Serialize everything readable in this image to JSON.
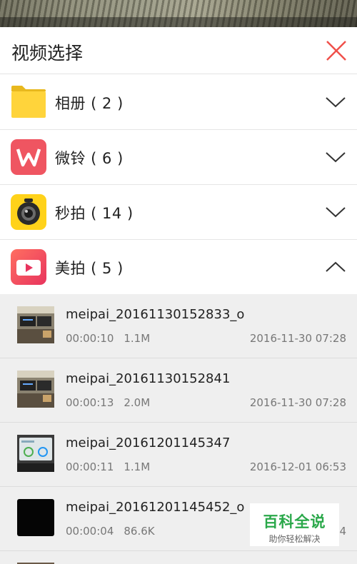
{
  "dialog": {
    "title": "视频选择"
  },
  "categories": [
    {
      "label": "相册 ( 2 )",
      "expanded": false,
      "icon": "folder-icon"
    },
    {
      "label": "微铃 ( 6 )",
      "expanded": false,
      "icon": "weiling-app-icon"
    },
    {
      "label": "秒拍 ( 14 )",
      "expanded": false,
      "icon": "miaopai-app-icon"
    },
    {
      "label": "美拍 ( 5 )",
      "expanded": true,
      "icon": "meipai-app-icon"
    }
  ],
  "videos": [
    {
      "name": "meipai_20161130152833_o",
      "duration": "00:00:10",
      "size": "1.1M",
      "date": "2016-11-30 07:28"
    },
    {
      "name": "meipai_20161130152841",
      "duration": "00:00:13",
      "size": "2.0M",
      "date": "2016-11-30 07:28"
    },
    {
      "name": "meipai_20161201145347",
      "duration": "00:00:11",
      "size": "1.1M",
      "date": "2016-12-01 06:53"
    },
    {
      "name": "meipai_20161201145452_o",
      "duration": "00:00:04",
      "size": "86.6K",
      "date": "4"
    }
  ],
  "watermark": {
    "title": "百科全说",
    "subtitle": "助你轻松解决"
  },
  "colors": {
    "close": "#f0504a",
    "folder": "#ffd43b",
    "weiling": "#ef5561",
    "miaopai": "#ffd21a",
    "meipai": "#f0485f",
    "watermark": "#2aa84a"
  }
}
